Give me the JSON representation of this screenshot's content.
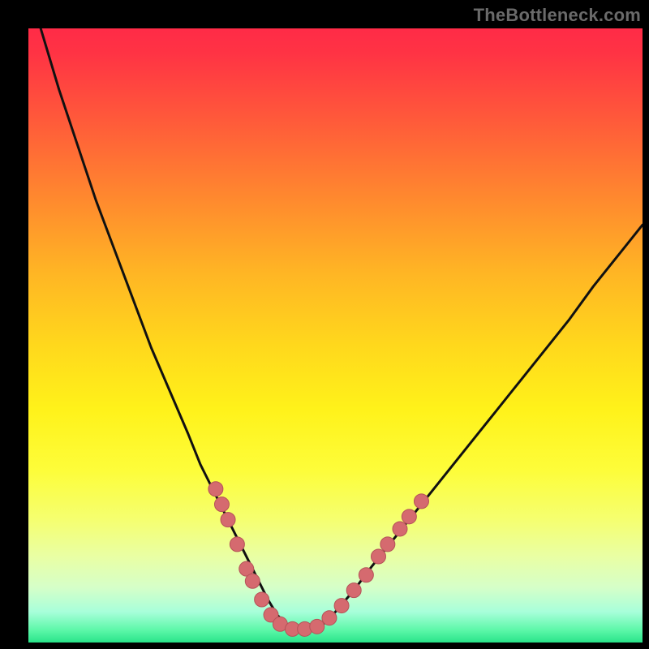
{
  "watermark": "TheBottleneck.com",
  "colors": {
    "frame": "#000000",
    "curve": "#111111",
    "marker_fill": "#d56a6f",
    "marker_stroke": "#b55258",
    "gradient_stops": [
      "#ff2b47",
      "#ff5a3a",
      "#ffb624",
      "#fff21a",
      "#e9ffa4",
      "#29e48a"
    ]
  },
  "chart_data": {
    "type": "line",
    "title": "",
    "xlabel": "",
    "ylabel": "",
    "xlim": [
      0,
      100
    ],
    "ylim": [
      0,
      100
    ],
    "grid": false,
    "legend": false,
    "series": [
      {
        "name": "curve",
        "x": [
          0,
          2,
          5,
          8,
          11,
          14,
          17,
          20,
          23,
          26,
          28,
          30,
          32,
          34,
          36,
          37.5,
          39,
          40.5,
          42,
          44,
          46,
          48,
          50,
          53,
          56,
          60,
          64,
          68,
          72,
          76,
          80,
          84,
          88,
          92,
          96,
          100
        ],
        "y": [
          108,
          100,
          90,
          81,
          72,
          64,
          56,
          48,
          41,
          34,
          29,
          25,
          21,
          17,
          13,
          10,
          7,
          4.5,
          3,
          2.2,
          2.2,
          3,
          5,
          8.5,
          12.5,
          17.5,
          22.5,
          27.5,
          32.5,
          37.5,
          42.5,
          47.5,
          52.5,
          58,
          63,
          68
        ]
      }
    ],
    "markers": {
      "name": "highlighted-points",
      "points": [
        {
          "x": 30.5,
          "y": 25
        },
        {
          "x": 31.5,
          "y": 22.5
        },
        {
          "x": 32.5,
          "y": 20
        },
        {
          "x": 34,
          "y": 16
        },
        {
          "x": 35.5,
          "y": 12
        },
        {
          "x": 36.5,
          "y": 10
        },
        {
          "x": 38,
          "y": 7
        },
        {
          "x": 39.5,
          "y": 4.5
        },
        {
          "x": 41,
          "y": 3
        },
        {
          "x": 43,
          "y": 2.2
        },
        {
          "x": 45,
          "y": 2.2
        },
        {
          "x": 47,
          "y": 2.6
        },
        {
          "x": 49,
          "y": 4
        },
        {
          "x": 51,
          "y": 6
        },
        {
          "x": 53,
          "y": 8.5
        },
        {
          "x": 55,
          "y": 11
        },
        {
          "x": 57,
          "y": 14
        },
        {
          "x": 58.5,
          "y": 16
        },
        {
          "x": 60.5,
          "y": 18.5
        },
        {
          "x": 62,
          "y": 20.5
        },
        {
          "x": 64,
          "y": 23
        }
      ]
    }
  }
}
